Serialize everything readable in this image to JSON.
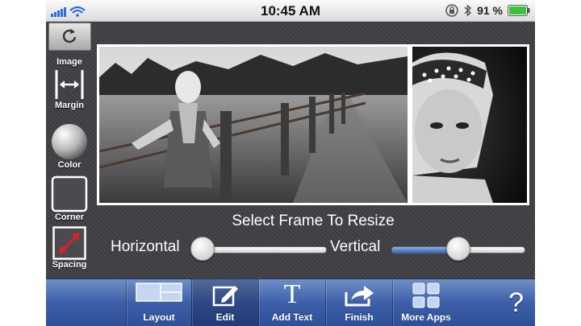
{
  "status_bar": {
    "time": "10:45 AM",
    "battery_percent": "91 %"
  },
  "side_tools": {
    "image_label": "Image",
    "margin_label": "Margin",
    "color_label": "Color",
    "corner_label": "Corner",
    "spacing_label": "Spacing"
  },
  "main": {
    "select_label": "Select Frame To Resize",
    "horizontal_label": "Horizontal",
    "vertical_label": "Vertical",
    "horizontal_value": 0.07,
    "vertical_value": 0.5
  },
  "toolbar": {
    "layout_label": "Layout",
    "edit_label": "Edit",
    "add_text_label": "Add Text",
    "finish_label": "Finish",
    "more_apps_label": "More Apps",
    "help_symbol": "?",
    "add_text_glyph": "T"
  },
  "colors": {
    "toolbar_blue": "#3c5fa8",
    "slider_fill": "#2f62c0",
    "battery_green": "#3cc23c"
  }
}
